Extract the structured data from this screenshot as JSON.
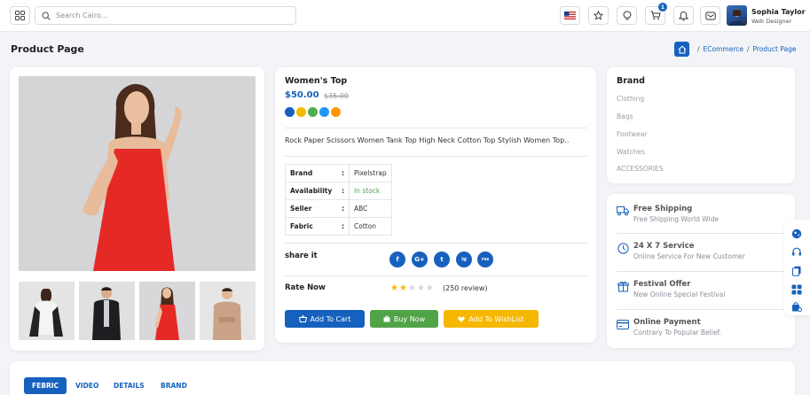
{
  "header": {
    "search_placeholder": "Search Cairo...",
    "cart_badge": "1",
    "user_name": "Sophia Taylor",
    "user_role": "Web Designer"
  },
  "page": {
    "title": "Product Page",
    "breadcrumb": [
      "ECommerce",
      "Product Page"
    ]
  },
  "product": {
    "name": "Women's Top",
    "price": "$50.00",
    "old_price": "$35.00",
    "swatches": [
      "#1661be",
      "#f5b700",
      "#4caf50",
      "#2196f3",
      "#ff9800"
    ],
    "description": "Rock Paper Scissors Women Tank Top High Neck Cotton Top Stylish Women Top..",
    "specs": [
      {
        "key": "Brand",
        "sep": ":",
        "value": "Pixelstrap"
      },
      {
        "key": "Availability",
        "sep": ":",
        "value": "In stock"
      },
      {
        "key": "Seller",
        "sep": ":",
        "value": "ABC"
      },
      {
        "key": "Fabric",
        "sep": ":",
        "value": "Cotton"
      }
    ],
    "share_label": "share it",
    "social": [
      "f",
      "G+",
      "t",
      "ig",
      "rss"
    ],
    "rate_label": "Rate Now",
    "rating": 2,
    "rating_max": 5,
    "review_text": "(250 review)",
    "buttons": {
      "cart": "Add To Cart",
      "buy": "Buy Now",
      "wishlist": "Add To WishList"
    }
  },
  "brand": {
    "title": "Brand",
    "items": [
      "Clothing",
      "Bags",
      "Footwear",
      "Watches",
      "ACCESSORIES"
    ]
  },
  "services": [
    {
      "icon": "truck-icon",
      "title": "Free Shipping",
      "subtitle": "Free Shipping World Wide"
    },
    {
      "icon": "clock-icon",
      "title": "24 X 7 Service",
      "subtitle": "Online Service For New Customer"
    },
    {
      "icon": "gift-icon",
      "title": "Festival Offer",
      "subtitle": "New Online Special Festival"
    },
    {
      "icon": "card-icon",
      "title": "Online Payment",
      "subtitle": "Contrary To Popular Belief."
    }
  ],
  "tabs": [
    "FEBRIC",
    "VIDEO",
    "DETAILS",
    "BRAND"
  ],
  "colors": {
    "accent": "#1661be",
    "success": "#51a347",
    "warning": "#f5b700",
    "star": "#f5b700"
  }
}
